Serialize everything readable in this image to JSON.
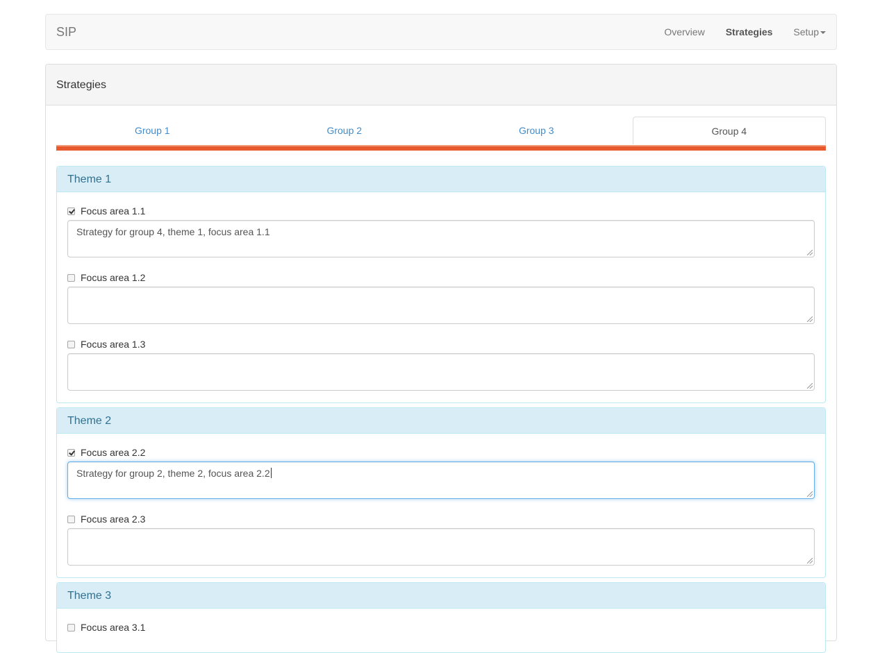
{
  "navbar": {
    "brand": "SIP",
    "items": [
      {
        "label": "Overview",
        "active": false
      },
      {
        "label": "Strategies",
        "active": true
      },
      {
        "label": "Setup",
        "active": false
      }
    ]
  },
  "panel": {
    "title": "Strategies",
    "tabs": [
      {
        "label": "Group 1"
      },
      {
        "label": "Group 2"
      },
      {
        "label": "Group 3"
      },
      {
        "label": "Group 4"
      }
    ],
    "active_tab": "Group 4",
    "accent_color": "#e8592d"
  },
  "themes": [
    {
      "title": "Theme 1",
      "focus_areas": [
        {
          "label": "Focus area 1.1",
          "checked": true,
          "value": "Strategy for group 4, theme 1, focus area 1.1"
        },
        {
          "label": "Focus area 1.2",
          "checked": false,
          "value": ""
        },
        {
          "label": "Focus area 1.3",
          "checked": false,
          "value": ""
        }
      ]
    },
    {
      "title": "Theme 2",
      "focus_areas": [
        {
          "label": "Focus area 2.2",
          "checked": true,
          "value": "Strategy for group 2, theme 2, focus area 2.2"
        },
        {
          "label": "Focus area 2.3",
          "checked": false,
          "value": ""
        }
      ]
    },
    {
      "title": "Theme 3",
      "focus_areas": [
        {
          "label": "Focus area 3.1",
          "checked": false,
          "value": ""
        }
      ]
    }
  ]
}
